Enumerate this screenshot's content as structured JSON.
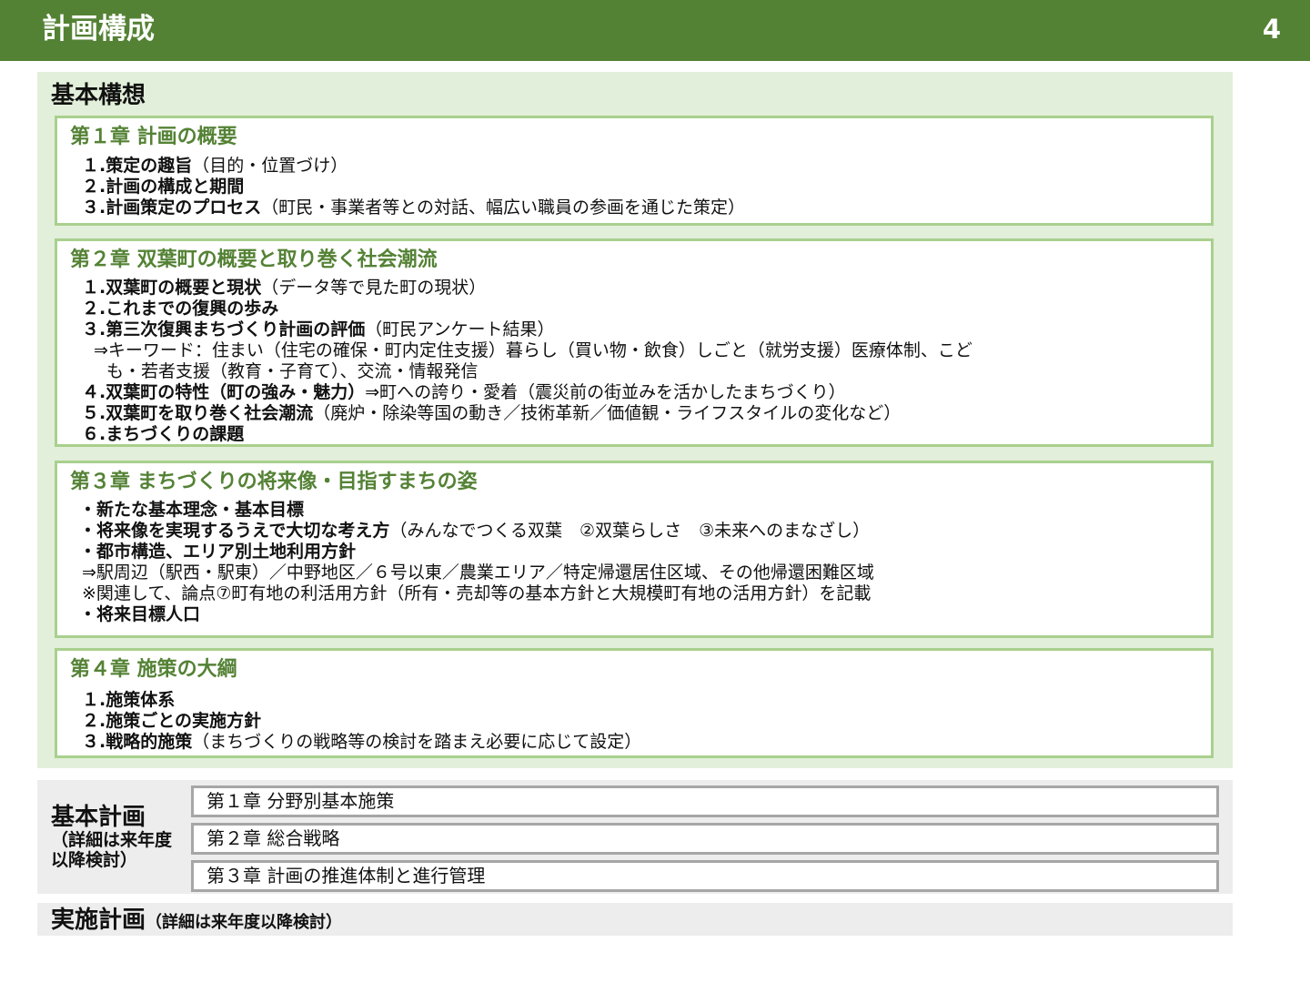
{
  "header": {
    "title": "計画構成",
    "page_number": "4"
  },
  "concept": {
    "title": "基本構想",
    "chapters": [
      {
        "title": "第１章 計画の概要",
        "items": [
          {
            "num": "１.",
            "bold": "策定の趣旨",
            "rest": "（目的・位置づけ）"
          },
          {
            "num": "２.",
            "bold": "計画の構成と期間",
            "rest": ""
          },
          {
            "num": "３.",
            "bold": "計画策定のプロセス",
            "rest": "（町民・事業者等との対話、幅広い職員の参画を通じた策定）"
          }
        ]
      },
      {
        "title": "第２章 双葉町の概要と取り巻く社会潮流",
        "items": [
          {
            "num": "１.",
            "bold": "双葉町の概要と現状",
            "rest": "（データ等で見た町の現状）"
          },
          {
            "num": "２.",
            "bold": "これまでの復興の歩み",
            "rest": ""
          },
          {
            "num": "３.",
            "bold": "第三次復興まちづくり計画の評価",
            "rest": "（町民アンケート結果）"
          },
          {
            "num": "４.",
            "bold": "双葉町の特性（町の強み・魅力）",
            "rest": "⇒町への誇り・愛着（震災前の街並みを活かしたまちづくり）"
          },
          {
            "num": "５.",
            "bold": "双葉町を取り巻く社会潮流",
            "rest": "（廃炉・除染等国の動き／技術革新／価値観・ライフスタイルの変化など）"
          },
          {
            "num": "６.",
            "bold": "まちづくりの課題",
            "rest": ""
          }
        ],
        "keyword_line1": "⇒キーワード：住まい（住宅の確保・町内定住支援）暮らし（買い物・飲食）しごと（就労支援）医療体制、こど",
        "keyword_line2": "も・若者支援（教育・子育て）、交流・情報発信"
      },
      {
        "title": "第３章 まちづくりの将来像・目指すまちの姿",
        "bullets": [
          {
            "bold": "・新たな基本理念・基本目標",
            "rest": ""
          },
          {
            "bold": "・将来像を実現するうえで大切な考え方",
            "rest": "（みんなでつくる双葉　②双葉らしさ　③未来へのまなざし）"
          },
          {
            "bold": "・都市構造、エリア別土地利用方針",
            "rest": ""
          },
          {
            "bold": "・将来目標人口",
            "rest": ""
          }
        ],
        "area_line": "⇒駅周辺（駅西・駅東）／中野地区／６号以東／農業エリア／特定帰還居住区域、その他帰還困難区域",
        "note_line": "※関連して、論点⑦町有地の利活用方針（所有・売却等の基本方針と大規模町有地の活用方針）を記載"
      },
      {
        "title": "第４章 施策の大綱",
        "items": [
          {
            "num": "１.",
            "bold": "施策体系",
            "rest": ""
          },
          {
            "num": "２.",
            "bold": "施策ごとの実施方針",
            "rest": ""
          },
          {
            "num": "３.",
            "bold": "戦略的施策",
            "rest": "（まちづくりの戦略等の検討を踏まえ必要に応じて設定）"
          }
        ]
      }
    ]
  },
  "basic_plan": {
    "title": "基本計画",
    "subtitle_line1": "（詳細は来年度",
    "subtitle_line2": "以降検討）",
    "chapters": [
      "第１章 分野別基本施策",
      "第２章 総合戦略",
      "第３章 計画の推進体制と進行管理"
    ]
  },
  "implementation_plan": {
    "title": "実施計画",
    "note": "（詳細は来年度以降検討）"
  },
  "colors": {
    "header_green": "#548235",
    "panel_green": "#e2efda",
    "box_border": "#a9d08e",
    "gray_panel": "#ededed"
  }
}
